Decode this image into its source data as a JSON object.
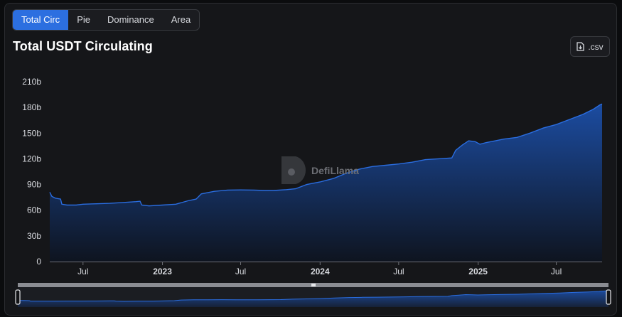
{
  "tabs": [
    {
      "label": "Total Circ",
      "active": true
    },
    {
      "label": "Pie",
      "active": false
    },
    {
      "label": "Dominance",
      "active": false
    },
    {
      "label": "Area",
      "active": false
    }
  ],
  "title": "Total USDT Circulating",
  "csv_button": {
    "label": ".csv",
    "icon": "file-download-icon"
  },
  "watermark": {
    "text": "DefiLlama"
  },
  "colors": {
    "line": "#2a6de0",
    "area_top": "#1c4fa8",
    "area_bottom": "#0e1420",
    "background": "#151619"
  },
  "chart_data": {
    "type": "area",
    "title": "Total USDT Circulating",
    "xlabel": "",
    "ylabel": "",
    "ylim": [
      0,
      210
    ],
    "y_unit": "b",
    "y_ticks": [
      "0",
      "30b",
      "60b",
      "90b",
      "120b",
      "150b",
      "180b",
      "210b"
    ],
    "y_tick_values": [
      0,
      30,
      60,
      90,
      120,
      150,
      180,
      210
    ],
    "x_range": [
      "2022-04-15",
      "2025-10-15"
    ],
    "x_ticks": [
      {
        "label": "Jul",
        "date": "2022-07-01",
        "bold": false
      },
      {
        "label": "2023",
        "date": "2023-01-01",
        "bold": true
      },
      {
        "label": "Jul",
        "date": "2023-07-01",
        "bold": false
      },
      {
        "label": "2024",
        "date": "2024-01-01",
        "bold": true
      },
      {
        "label": "Jul",
        "date": "2024-07-01",
        "bold": false
      },
      {
        "label": "2025",
        "date": "2025-01-01",
        "bold": true
      },
      {
        "label": "Jul",
        "date": "2025-07-01",
        "bold": false
      }
    ],
    "grid": false,
    "legend": "none",
    "series": [
      {
        "points": [
          [
            "2022-04-15",
            81
          ],
          [
            "2022-04-20",
            76
          ],
          [
            "2022-04-28",
            74
          ],
          [
            "2022-05-10",
            73
          ],
          [
            "2022-05-13",
            67
          ],
          [
            "2022-05-25",
            66
          ],
          [
            "2022-06-15",
            66
          ],
          [
            "2022-07-01",
            67
          ],
          [
            "2022-08-01",
            67.5
          ],
          [
            "2022-09-01",
            68
          ],
          [
            "2022-10-01",
            69
          ],
          [
            "2022-11-01",
            70
          ],
          [
            "2022-11-10",
            70.5
          ],
          [
            "2022-11-14",
            66
          ],
          [
            "2022-12-01",
            65
          ],
          [
            "2023-01-01",
            66
          ],
          [
            "2023-02-01",
            67
          ],
          [
            "2023-03-01",
            71
          ],
          [
            "2023-03-20",
            73
          ],
          [
            "2023-04-01",
            79
          ],
          [
            "2023-05-01",
            82
          ],
          [
            "2023-06-01",
            83.5
          ],
          [
            "2023-07-01",
            83.7
          ],
          [
            "2023-08-01",
            83.5
          ],
          [
            "2023-08-25",
            83
          ],
          [
            "2023-09-15",
            83
          ],
          [
            "2023-10-15",
            84
          ],
          [
            "2023-11-05",
            85
          ],
          [
            "2023-12-01",
            90
          ],
          [
            "2024-01-01",
            93
          ],
          [
            "2024-02-01",
            97
          ],
          [
            "2024-03-01",
            103
          ],
          [
            "2024-04-01",
            108
          ],
          [
            "2024-05-01",
            111
          ],
          [
            "2024-06-01",
            112.5
          ],
          [
            "2024-07-01",
            114
          ],
          [
            "2024-08-01",
            116
          ],
          [
            "2024-09-01",
            119
          ],
          [
            "2024-10-01",
            120
          ],
          [
            "2024-11-01",
            121
          ],
          [
            "2024-11-10",
            130
          ],
          [
            "2024-11-25",
            136
          ],
          [
            "2024-12-10",
            141
          ],
          [
            "2024-12-25",
            140
          ],
          [
            "2025-01-05",
            137
          ],
          [
            "2025-01-20",
            139
          ],
          [
            "2025-02-10",
            141
          ],
          [
            "2025-03-01",
            143
          ],
          [
            "2025-04-01",
            145
          ],
          [
            "2025-05-01",
            150
          ],
          [
            "2025-06-01",
            156
          ],
          [
            "2025-07-01",
            160
          ],
          [
            "2025-08-01",
            166
          ],
          [
            "2025-09-01",
            172
          ],
          [
            "2025-09-25",
            178
          ],
          [
            "2025-10-10",
            183
          ],
          [
            "2025-10-15",
            184
          ]
        ]
      }
    ]
  }
}
